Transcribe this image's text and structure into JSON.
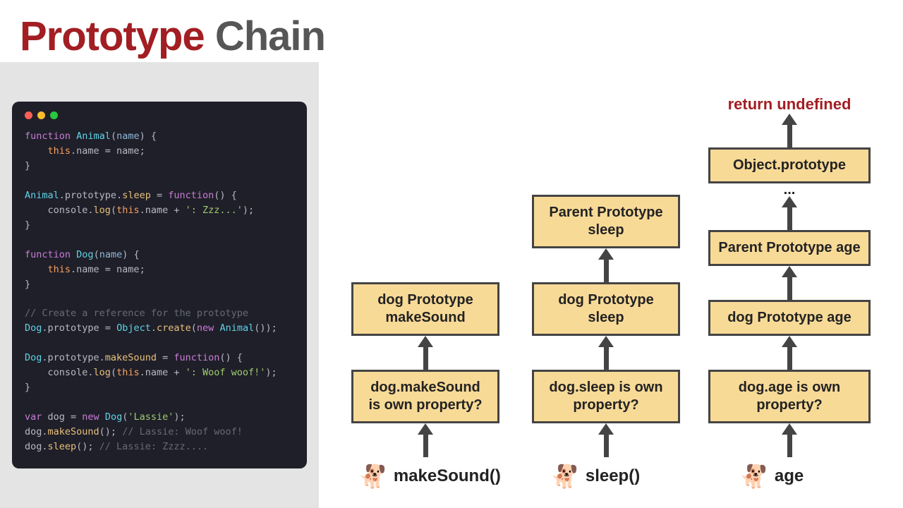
{
  "title": {
    "red": "Prototype",
    "gray": "Chain"
  },
  "code": {
    "lines": [
      [
        [
          "function",
          "k-purple"
        ],
        [
          " ",
          "d"
        ],
        [
          "Animal",
          "k-cyan"
        ],
        [
          "(",
          "d"
        ],
        [
          "name",
          "k-lightblue"
        ],
        [
          ") {",
          "d"
        ]
      ],
      [
        [
          "    ",
          "d"
        ],
        [
          "this",
          "k-orange"
        ],
        [
          ".name = name;",
          "d"
        ]
      ],
      [
        [
          "}",
          "d"
        ]
      ],
      [
        [
          "",
          "d"
        ]
      ],
      [
        [
          "Animal",
          "k-cyan"
        ],
        [
          ".prototype.",
          "d"
        ],
        [
          "sleep",
          "k-yellow"
        ],
        [
          " = ",
          "d"
        ],
        [
          "function",
          "k-purple"
        ],
        [
          "() {",
          "d"
        ]
      ],
      [
        [
          "    console.",
          "d"
        ],
        [
          "log",
          "k-yellow"
        ],
        [
          "(",
          "d"
        ],
        [
          "this",
          "k-orange"
        ],
        [
          ".name + ",
          "d"
        ],
        [
          "': Zzz...'",
          "k-green"
        ],
        [
          ");",
          "d"
        ]
      ],
      [
        [
          "}",
          "d"
        ]
      ],
      [
        [
          "",
          "d"
        ]
      ],
      [
        [
          "function",
          "k-purple"
        ],
        [
          " ",
          "d"
        ],
        [
          "Dog",
          "k-cyan"
        ],
        [
          "(",
          "d"
        ],
        [
          "name",
          "k-lightblue"
        ],
        [
          ") {",
          "d"
        ]
      ],
      [
        [
          "    ",
          "d"
        ],
        [
          "this",
          "k-orange"
        ],
        [
          ".name = name;",
          "d"
        ]
      ],
      [
        [
          "}",
          "d"
        ]
      ],
      [
        [
          "",
          "d"
        ]
      ],
      [
        [
          "// Create a reference for the prototype",
          "k-comment"
        ]
      ],
      [
        [
          "Dog",
          "k-cyan"
        ],
        [
          ".prototype = ",
          "d"
        ],
        [
          "Object",
          "k-cyan"
        ],
        [
          ".",
          "d"
        ],
        [
          "create",
          "k-yellow"
        ],
        [
          "(",
          "d"
        ],
        [
          "new",
          "k-purple"
        ],
        [
          " ",
          "d"
        ],
        [
          "Animal",
          "k-cyan"
        ],
        [
          "());",
          "d"
        ]
      ],
      [
        [
          "",
          "d"
        ]
      ],
      [
        [
          "Dog",
          "k-cyan"
        ],
        [
          ".prototype.",
          "d"
        ],
        [
          "makeSound",
          "k-yellow"
        ],
        [
          " = ",
          "d"
        ],
        [
          "function",
          "k-purple"
        ],
        [
          "() {",
          "d"
        ]
      ],
      [
        [
          "    console.",
          "d"
        ],
        [
          "log",
          "k-yellow"
        ],
        [
          "(",
          "d"
        ],
        [
          "this",
          "k-orange"
        ],
        [
          ".name + ",
          "d"
        ],
        [
          "': Woof woof!'",
          "k-green"
        ],
        [
          ");",
          "d"
        ]
      ],
      [
        [
          "}",
          "d"
        ]
      ],
      [
        [
          "",
          "d"
        ]
      ],
      [
        [
          "var",
          "k-purple"
        ],
        [
          " dog = ",
          "d"
        ],
        [
          "new",
          "k-purple"
        ],
        [
          " ",
          "d"
        ],
        [
          "Dog",
          "k-cyan"
        ],
        [
          "(",
          "d"
        ],
        [
          "'Lassie'",
          "k-green"
        ],
        [
          ");",
          "d"
        ]
      ],
      [
        [
          "dog.",
          "d"
        ],
        [
          "makeSound",
          "k-yellow"
        ],
        [
          "(); ",
          "d"
        ],
        [
          "// Lassie: Woof woof!",
          "k-comment"
        ]
      ],
      [
        [
          "dog.",
          "d"
        ],
        [
          "sleep",
          "k-yellow"
        ],
        [
          "(); ",
          "d"
        ],
        [
          "// Lassie: Zzzz....",
          "k-comment"
        ]
      ]
    ]
  },
  "columns": [
    {
      "start": "makeSound()",
      "boxes": [
        "dog.makeSound\nis own property?",
        "dog Prototype makeSound"
      ],
      "top": null,
      "ellipsis": false
    },
    {
      "start": "sleep()",
      "boxes": [
        "dog.sleep is own property?",
        "dog Prototype sleep",
        "Parent Prototype sleep"
      ],
      "top": null,
      "ellipsis": false
    },
    {
      "start": "age",
      "boxes": [
        "dog.age is own property?",
        "dog Prototype age",
        "Parent Prototype age",
        "Object.prototype"
      ],
      "top": "return undefined",
      "ellipsis": true
    }
  ]
}
